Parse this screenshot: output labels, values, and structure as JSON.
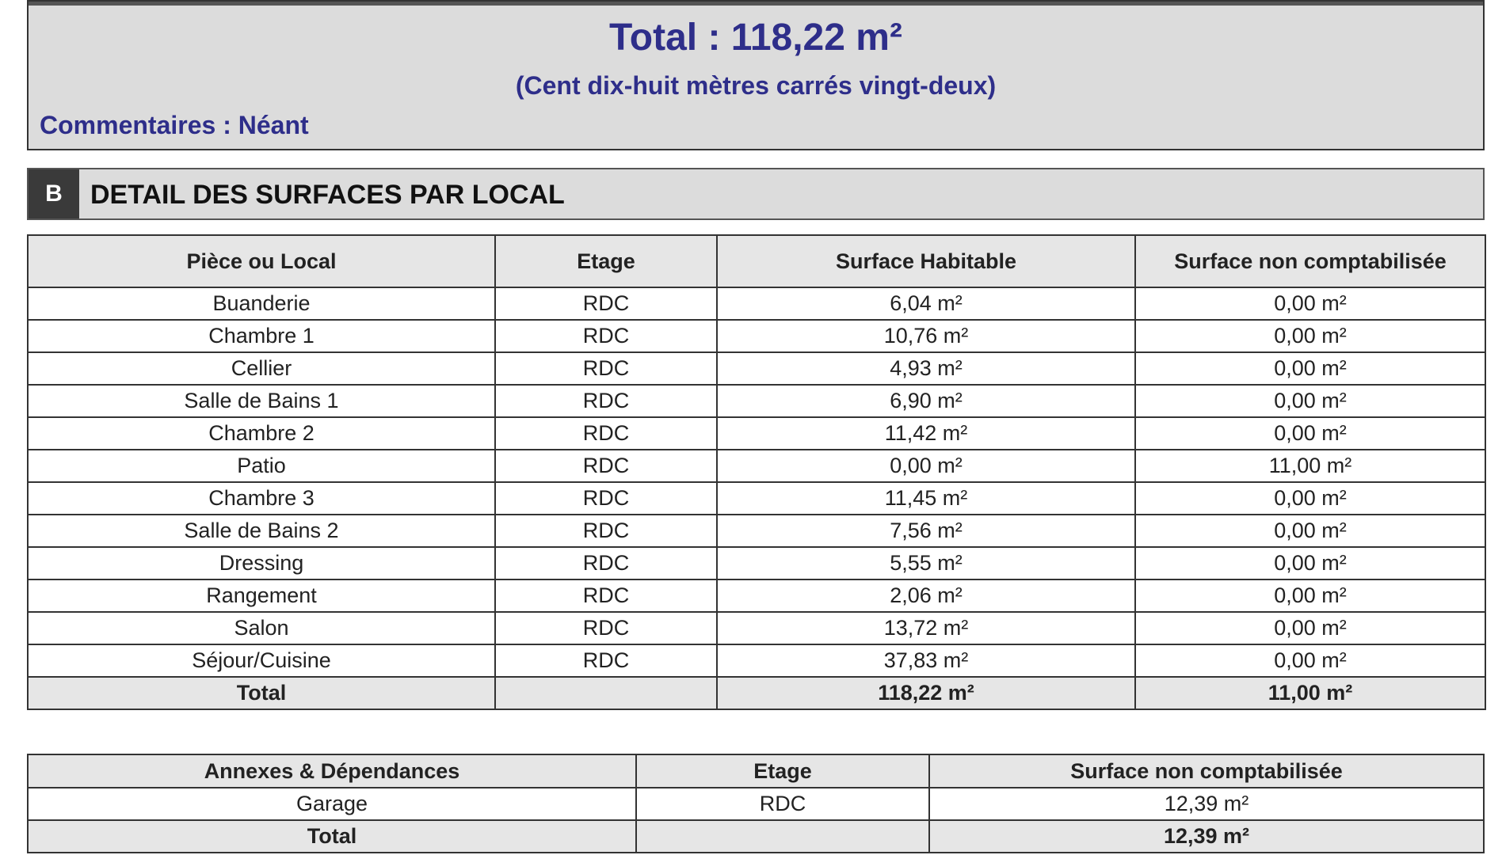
{
  "summary": {
    "total": "Total : 118,22 m²",
    "total_words": "(Cent dix-huit mètres carrés vingt-deux)",
    "comments": "Commentaires : Néant"
  },
  "section": {
    "badge": "B",
    "title": "DETAIL DES SURFACES PAR LOCAL"
  },
  "main_table": {
    "headers": [
      "Pièce ou Local",
      "Etage",
      "Surface Habitable",
      "Surface non comptabilisée"
    ],
    "rows": [
      [
        "Buanderie",
        "RDC",
        "6,04 m²",
        "0,00 m²"
      ],
      [
        "Chambre 1",
        "RDC",
        "10,76 m²",
        "0,00 m²"
      ],
      [
        "Cellier",
        "RDC",
        "4,93 m²",
        "0,00 m²"
      ],
      [
        "Salle de Bains 1",
        "RDC",
        "6,90 m²",
        "0,00 m²"
      ],
      [
        "Chambre 2",
        "RDC",
        "11,42 m²",
        "0,00 m²"
      ],
      [
        "Patio",
        "RDC",
        "0,00 m²",
        "11,00 m²"
      ],
      [
        "Chambre 3",
        "RDC",
        "11,45 m²",
        "0,00 m²"
      ],
      [
        "Salle de Bains 2",
        "RDC",
        "7,56 m²",
        "0,00 m²"
      ],
      [
        "Dressing",
        "RDC",
        "5,55 m²",
        "0,00 m²"
      ],
      [
        "Rangement",
        "RDC",
        "2,06 m²",
        "0,00 m²"
      ],
      [
        "Salon",
        "RDC",
        "13,72 m²",
        "0,00 m²"
      ],
      [
        "Séjour/Cuisine",
        "RDC",
        "37,83 m²",
        "0,00 m²"
      ]
    ],
    "total": [
      "Total",
      "",
      "118,22 m²",
      "11,00 m²"
    ]
  },
  "annex_table": {
    "headers": [
      "Annexes & Dépendances",
      "Etage",
      "Surface non comptabilisée"
    ],
    "rows": [
      [
        "Garage",
        "RDC",
        "12,39 m²"
      ]
    ],
    "total": [
      "Total",
      "",
      "12,39 m²"
    ]
  }
}
